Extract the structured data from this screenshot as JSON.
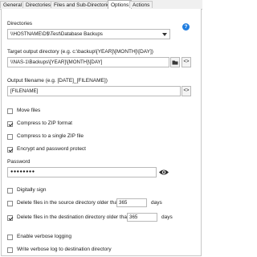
{
  "tabs": [
    "General",
    "Directories",
    "Files and Sub-Directories",
    "Options",
    "Actions"
  ],
  "active_tab": "Options",
  "directories": {
    "label": "Directories",
    "value": "\\\\HOSTNAME\\D$\\Test\\Database Backups"
  },
  "target": {
    "label": "Target output directory (e.g. c:\\backup\\[YEAR]\\[MONTH]\\[DAY])",
    "value": "\\\\NAS-1\\Backups\\[YEAR]\\[MONTH]\\[DAY]"
  },
  "filename": {
    "label": "Output filename (e.g. [DATE]_[FILENAME])",
    "value": "[FILENAME]"
  },
  "options": {
    "move_files": "Move files",
    "compress_zip": "Compress to ZIP format",
    "compress_single": "Compress to a single ZIP file",
    "encrypt": "Encrypt and password protect"
  },
  "password": {
    "label": "Password",
    "value": "●●●●●●●●"
  },
  "sign": {
    "digitally_sign": "Digitally sign",
    "delete_source": "Delete files in the source directory older than",
    "delete_source_value": "365",
    "delete_source_unit": "days",
    "delete_dest": "Delete files in the destination directory older than",
    "delete_dest_value": "365",
    "delete_dest_unit": "days"
  },
  "logging": {
    "verbose": "Enable verbose logging",
    "write_verbose": "Write verbose log to destination directory"
  },
  "icons": {
    "help": "?",
    "folder": "folder-icon",
    "code": "<>",
    "eye": "eye-icon"
  }
}
